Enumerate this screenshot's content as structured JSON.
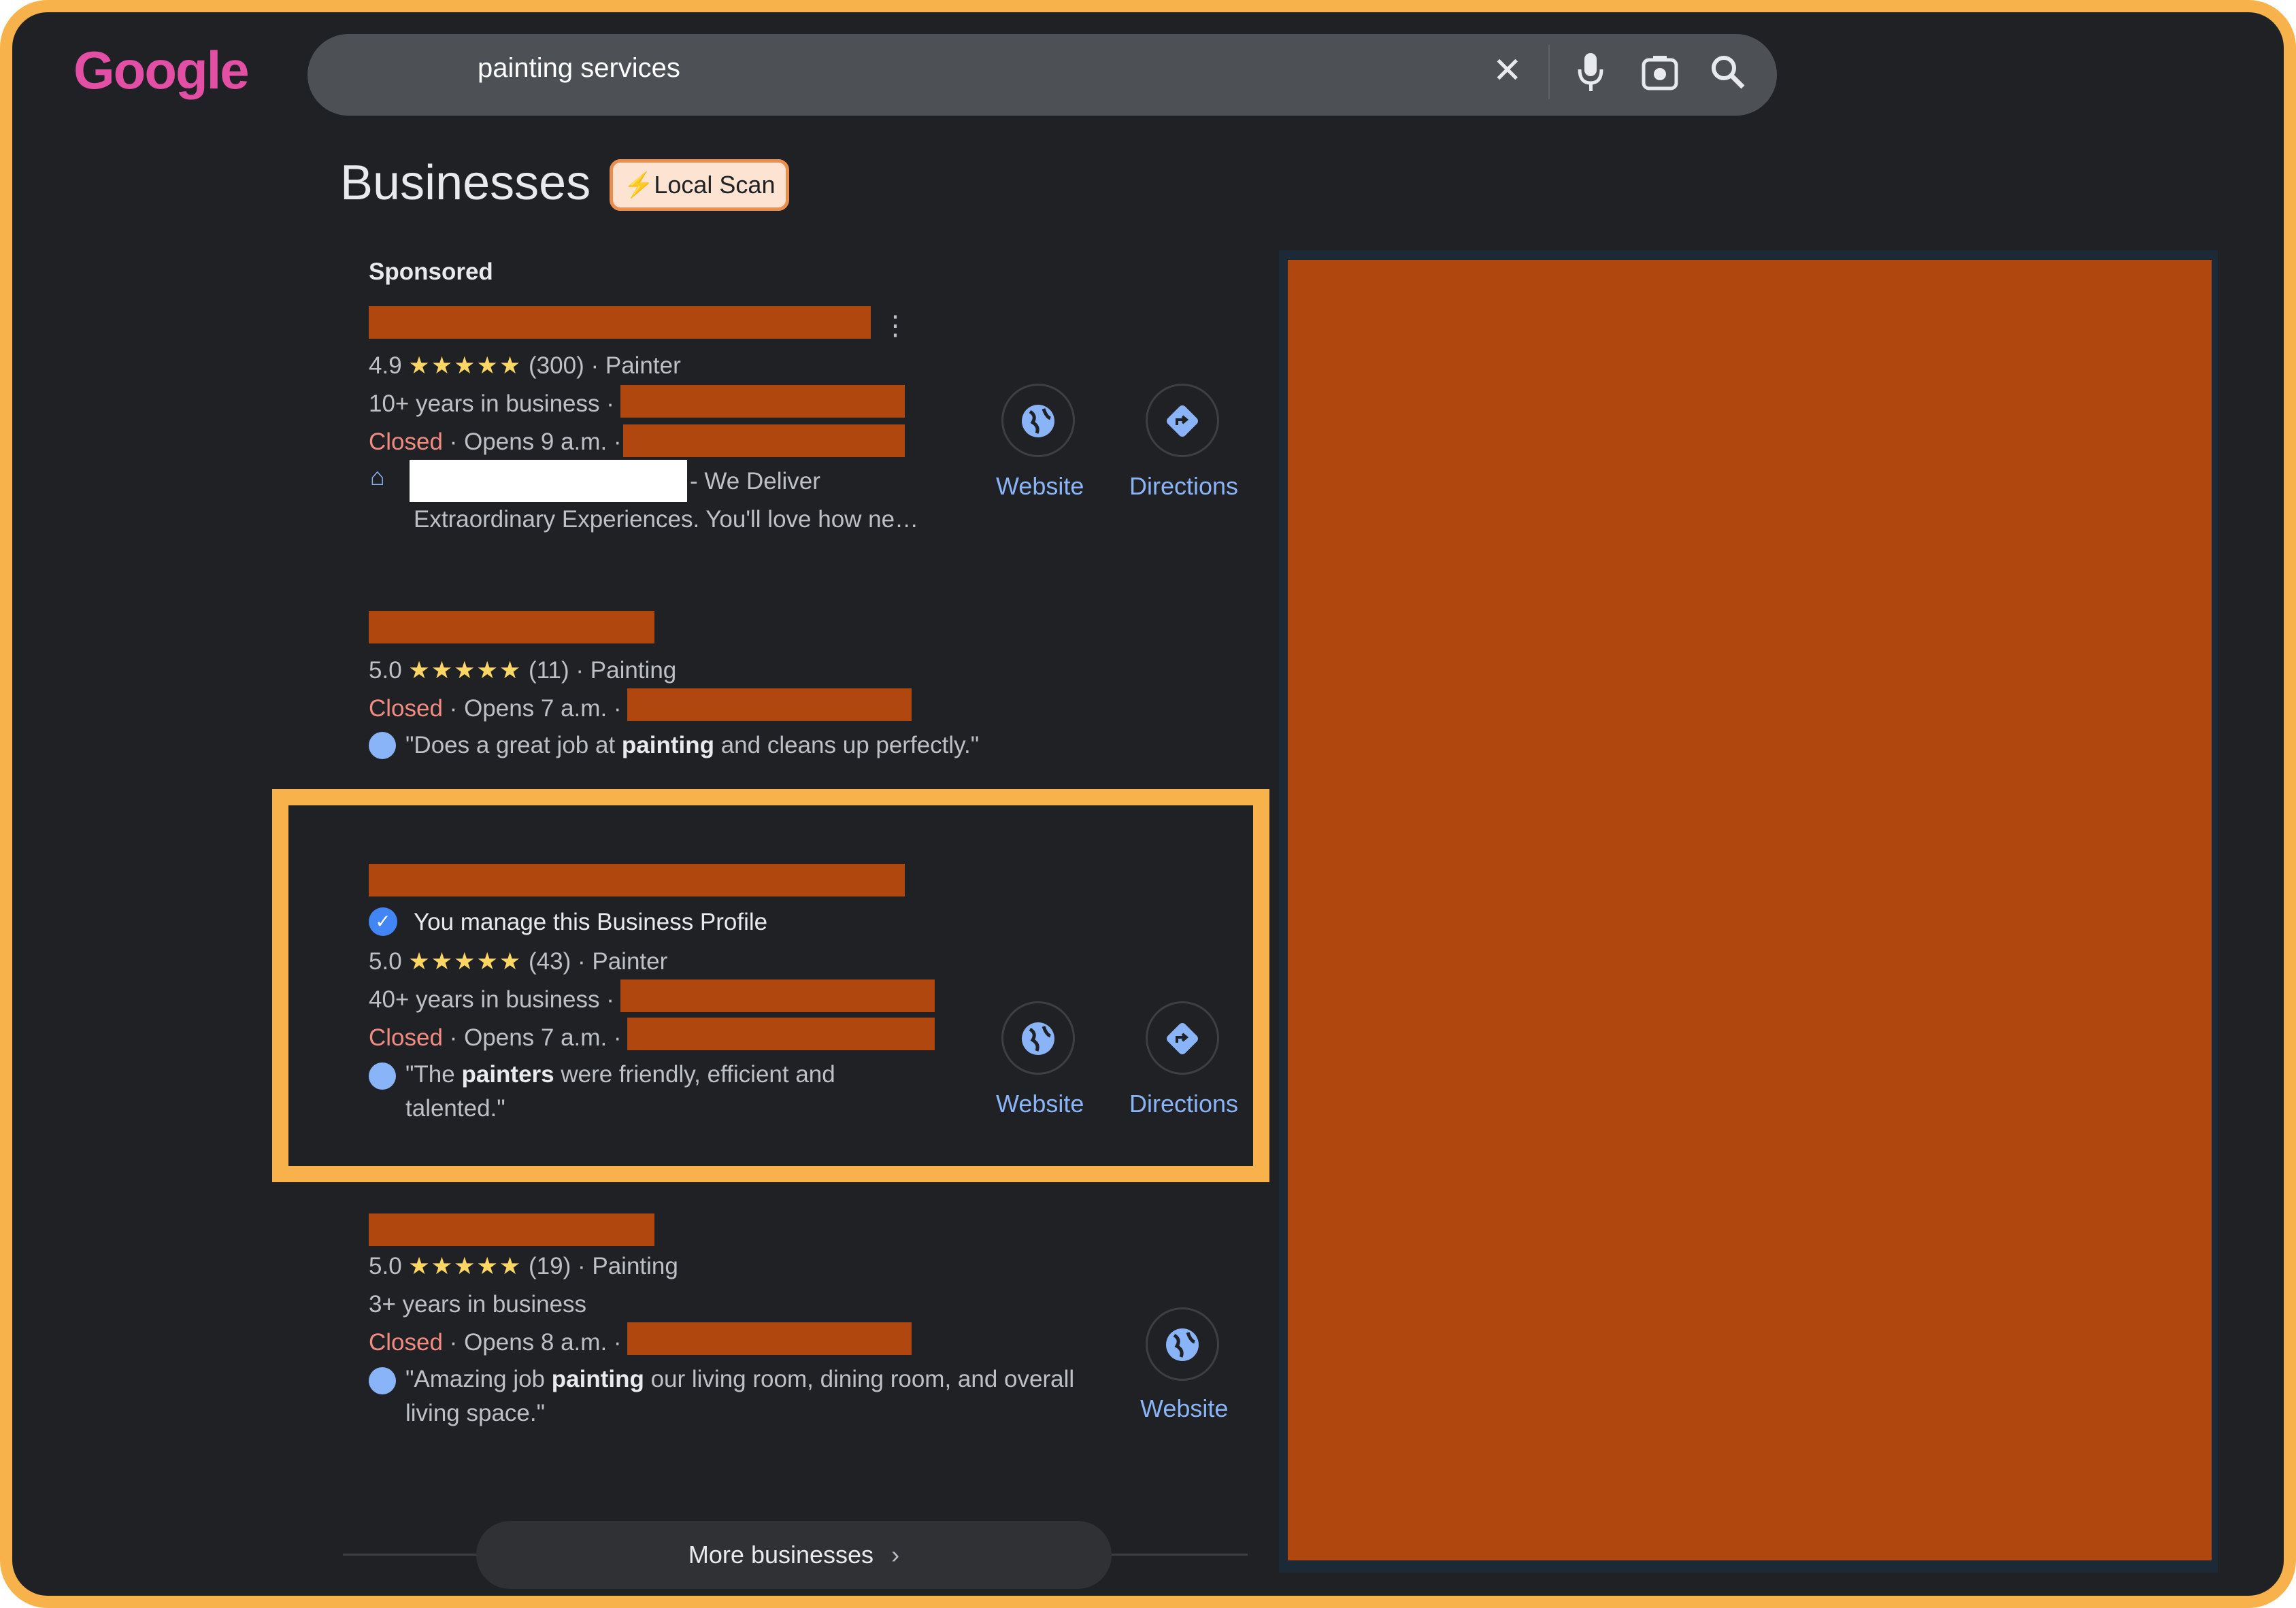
{
  "logo": {
    "text": "Google"
  },
  "search": {
    "query": "painting services"
  },
  "icons": {
    "clear": "close-icon",
    "voice": "mic-icon",
    "lens": "camera-lens-icon",
    "search": "search-icon",
    "website": "globe-icon",
    "directions": "directions-icon"
  },
  "heading": "Businesses",
  "badge": {
    "label": "Local Scan",
    "bolt": "⚡"
  },
  "sponsored_label": "Sponsored",
  "listings": [
    {
      "rating": "4.9",
      "stars": "★★★★★",
      "reviews": "(300)",
      "category": "Painter",
      "years": "10+ years in business",
      "status": "Closed",
      "opens": "Opens 9 a.m.",
      "desc_suffix": "- We Deliver",
      "desc_line2": "Extraordinary Experiences. You'll love how ne…",
      "website": "Website",
      "directions": "Directions"
    },
    {
      "rating": "5.0",
      "stars": "★★★★★",
      "reviews": "(11)",
      "category": "Painting",
      "status": "Closed",
      "opens": "Opens 7 a.m.",
      "review_pre": "\"Does a great job at ",
      "review_bold": "painting",
      "review_post": " and cleans up perfectly.\""
    },
    {
      "managed": "You manage this Business Profile",
      "rating": "5.0",
      "stars": "★★★★★",
      "reviews": "(43)",
      "category": "Painter",
      "years": "40+ years in business",
      "status": "Closed",
      "opens": "Opens 7 a.m.",
      "review_pre": "\"The ",
      "review_bold": "painters",
      "review_post": " were friendly, efficient and",
      "review_line2": "talented.\"",
      "website": "Website",
      "directions": "Directions"
    },
    {
      "rating": "5.0",
      "stars": "★★★★★",
      "reviews": "(19)",
      "category": "Painting",
      "years": "3+ years in business",
      "status": "Closed",
      "opens": "Opens 8 a.m.",
      "review_pre": "\"Amazing job ",
      "review_bold": "painting",
      "review_post": " our living room, dining room, and overall",
      "review_line2": "living space.\"",
      "website": "Website"
    }
  ],
  "more_businesses": "More businesses",
  "colors": {
    "frame": "#f7b24c",
    "background": "#202124",
    "redaction": "#b0470e",
    "link": "#8ab4f8",
    "closed": "#f28b82",
    "star": "#fdd663"
  }
}
